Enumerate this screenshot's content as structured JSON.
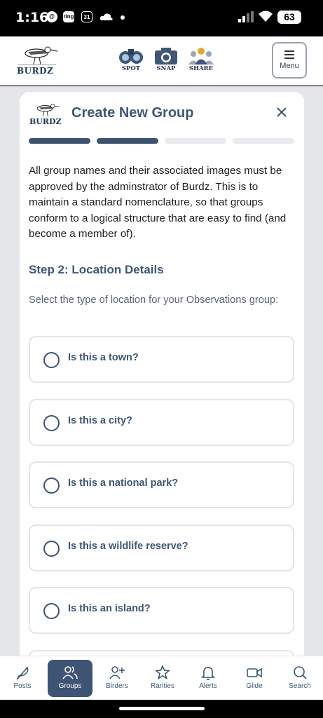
{
  "status": {
    "time": "1:16",
    "icons": [
      "threads-icon",
      "ring-icon",
      "calendar-icon",
      "cloud-icon"
    ],
    "ring_label": "ring",
    "calendar_label": "31",
    "battery": "63"
  },
  "header": {
    "logo_text": "BURDZ",
    "nav": [
      {
        "label": "SPOT",
        "icon": "binoculars-icon"
      },
      {
        "label": "SNAP",
        "icon": "camera-icon"
      },
      {
        "label": "SHARE",
        "icon": "people-icon"
      }
    ],
    "menu_label": "Menu"
  },
  "dialog": {
    "logo_text": "BURDZ",
    "title": "Create New Group",
    "progress": {
      "total_steps": 4,
      "completed_steps": 2
    },
    "intro": "All group names and their associated images must be approved by the adminstrator of Burdz. This is to maintain a standard nomenclature, so that groups conform to a logical structure that are easy to find (and become a member of).",
    "step_heading": "Step 2: Location Details",
    "prompt": "Select the type of location for your Observations group:",
    "options": [
      {
        "label": "Is this a town?"
      },
      {
        "label": "Is this a city?"
      },
      {
        "label": "Is this a national park?"
      },
      {
        "label": "Is this a wildlife reserve?"
      },
      {
        "label": "Is this an island?"
      }
    ]
  },
  "tabbar": {
    "active": "Groups",
    "tabs": [
      {
        "label": "Posts",
        "icon": "feather-icon"
      },
      {
        "label": "Groups",
        "icon": "groups-icon"
      },
      {
        "label": "Birders",
        "icon": "add-user-icon"
      },
      {
        "label": "Rarities",
        "icon": "star-icon"
      },
      {
        "label": "Alerts",
        "icon": "bell-icon"
      },
      {
        "label": "Glide",
        "icon": "video-icon"
      },
      {
        "label": "Search",
        "icon": "search-icon"
      }
    ]
  },
  "colors": {
    "brand": "#3f5676",
    "active_tab": "#3e5474",
    "progress_on": "#3c526f",
    "progress_off": "#e8eaee"
  }
}
